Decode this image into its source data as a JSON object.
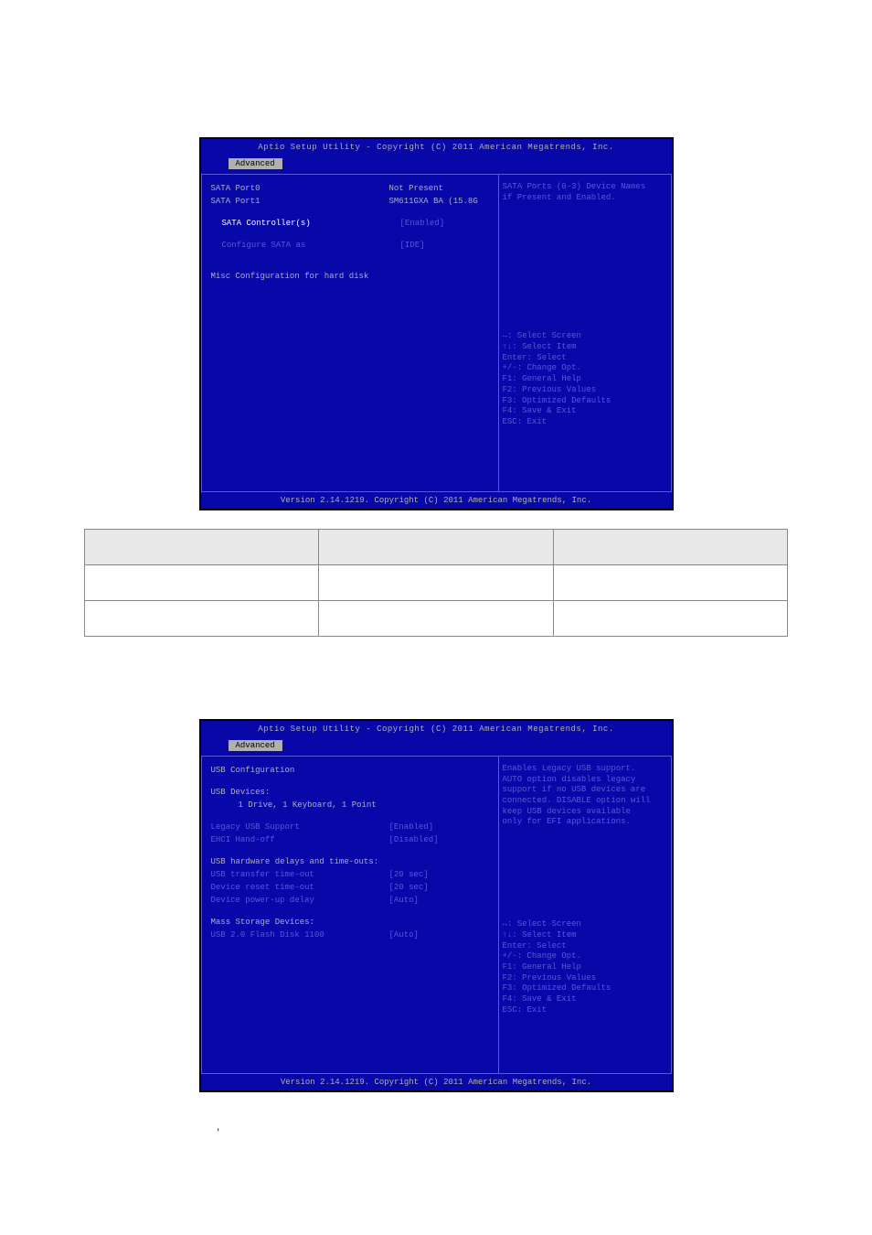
{
  "bios1": {
    "header": "Aptio Setup Utility - Copyright (C) 2011 American Megatrends, Inc.",
    "tab": "Advanced",
    "rows": {
      "port0_label": "SATA Port0",
      "port0_value": "Not Present",
      "port1_label": "SATA Port1",
      "port1_value": "SM611GXA BA    (15.8G",
      "controller_label": "SATA Controller(s)",
      "controller_value": "[Enabled]",
      "config_label": "Configure SATA as",
      "config_value": "[IDE]",
      "misc_label": "Misc Configuration for hard disk"
    },
    "help": {
      "desc1": "SATA Ports (0-3) Device Names",
      "desc2": "if Present and Enabled.",
      "k1": "↔: Select Screen",
      "k2": "↑↓: Select Item",
      "k3": "Enter: Select",
      "k4": "+/-: Change Opt.",
      "k5": "F1: General Help",
      "k6": "F2: Previous Values",
      "k7": "F3: Optimized Defaults",
      "k8": "F4: Save & Exit",
      "k9": "ESC: Exit"
    },
    "footer": "Version 2.14.1219. Copyright (C) 2011 American Megatrends, Inc."
  },
  "bios2": {
    "header": "Aptio Setup Utility - Copyright (C) 2011 American Megatrends, Inc.",
    "tab": "Advanced",
    "rows": {
      "title": "USB Configuration",
      "devices_label": "USB Devices:",
      "devices_value": "1 Drive, 1 Keyboard, 1 Point",
      "legacy_label": "Legacy USB Support",
      "legacy_value": "[Enabled]",
      "ehci_label": "EHCI Hand-off",
      "ehci_value": "[Disabled]",
      "hw_label": "USB hardware delays and time-outs:",
      "transfer_label": "USB transfer time-out",
      "transfer_value": "[20 sec]",
      "reset_label": "Device reset time-out",
      "reset_value": "[20 sec]",
      "powerup_label": "Device power-up delay",
      "powerup_value": "[Auto]",
      "mass_label": "Mass Storage Devices:",
      "flash_label": "USB 2.0 Flash Disk 1100",
      "flash_value": "[Auto]"
    },
    "help": {
      "desc1": "Enables Legacy USB support.",
      "desc2": "AUTO option disables legacy",
      "desc3": "support if no USB devices are",
      "desc4": "connected. DISABLE option will",
      "desc5": "keep USB devices available",
      "desc6": "only for EFI applications.",
      "k1": "↔: Select Screen",
      "k2": "↑↓: Select Item",
      "k3": "Enter: Select",
      "k4": "+/-: Change Opt.",
      "k5": "F1: General Help",
      "k6": "F2: Previous Values",
      "k7": "F3: Optimized Defaults",
      "k8": "F4: Save & Exit",
      "k9": "ESC: Exit"
    },
    "footer": "Version 2.14.1219. Copyright (C) 2011 American Megatrends, Inc."
  },
  "comma": ","
}
